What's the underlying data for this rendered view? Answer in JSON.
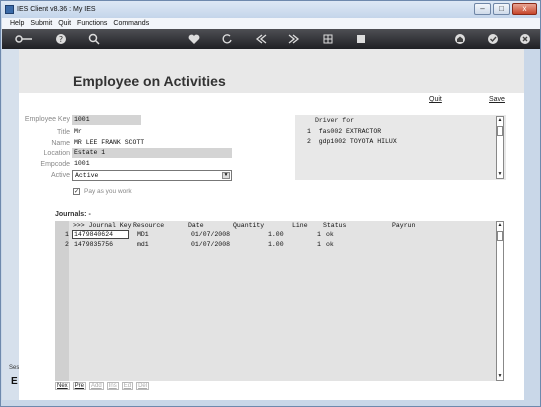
{
  "window": {
    "title": "IES Client v8.36 : My IES",
    "controls": {
      "minimize": "–",
      "maximize": "□",
      "close": "x"
    }
  },
  "menu": [
    "Help",
    "Submit",
    "Quit",
    "Functions",
    "Commands"
  ],
  "toolbar": {
    "icons": [
      "key-icon",
      "help-icon",
      "search-icon",
      "heart-icon",
      "refresh-icon",
      "rewind-icon",
      "fast-forward-icon",
      "grid-icon",
      "stop-icon",
      "home-icon",
      "check-icon",
      "close-icon"
    ]
  },
  "page": {
    "title": "Employee on Activities",
    "quit_label": "Quit",
    "save_label": "Save"
  },
  "form": {
    "employee_key": {
      "label": "Employee Key",
      "value": "1001"
    },
    "title": {
      "label": "Title",
      "value": "Mr"
    },
    "name": {
      "label": "Name",
      "value": "MR LEE FRANK SCOTT"
    },
    "location": {
      "label": "Location",
      "value": "Estate 1"
    },
    "empcode": {
      "label": "Empcode",
      "value": "1001"
    },
    "active": {
      "label": "Active",
      "value": "Active"
    },
    "pay_as_you_work": {
      "label": "Pay as you work",
      "checked": true
    }
  },
  "driver_for": {
    "header": "Driver for",
    "rows": [
      {
        "num": "1",
        "text": "fas002 EXTRACTOR"
      },
      {
        "num": "2",
        "text": "gdp1002 TOYOTA HILUX"
      }
    ]
  },
  "journals": {
    "label": "Journals: -",
    "columns": [
      ">>> Journal Key",
      "Resource",
      "Date",
      "Quantity",
      "Line",
      "Status",
      "Payrun"
    ],
    "rows": [
      {
        "num": "1",
        "journal_key": "1479840624",
        "resource": "MD1",
        "date": "01/07/2008",
        "quantity": "1.00",
        "line": "1",
        "status": "ok",
        "payrun": ""
      },
      {
        "num": "2",
        "journal_key": "1479835756",
        "resource": "md1",
        "date": "01/07/2008",
        "quantity": "1.00",
        "line": "1",
        "status": "ok",
        "payrun": ""
      }
    ]
  },
  "nav_buttons": {
    "nex": "Nex",
    "pre": "Pre",
    "add": "Add",
    "ins": "Ins",
    "ed": "Ed",
    "del": "Del"
  },
  "left_strip": {
    "text1": "Ses",
    "text2": "E"
  }
}
